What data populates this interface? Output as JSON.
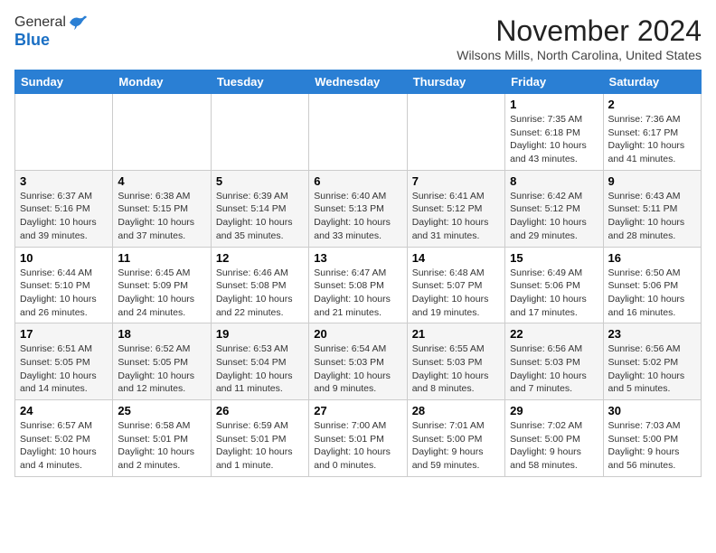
{
  "header": {
    "logo_general": "General",
    "logo_blue": "Blue",
    "month_title": "November 2024",
    "location": "Wilsons Mills, North Carolina, United States"
  },
  "days_of_week": [
    "Sunday",
    "Monday",
    "Tuesday",
    "Wednesday",
    "Thursday",
    "Friday",
    "Saturday"
  ],
  "weeks": [
    [
      {
        "day": "",
        "info": ""
      },
      {
        "day": "",
        "info": ""
      },
      {
        "day": "",
        "info": ""
      },
      {
        "day": "",
        "info": ""
      },
      {
        "day": "",
        "info": ""
      },
      {
        "day": "1",
        "info": "Sunrise: 7:35 AM\nSunset: 6:18 PM\nDaylight: 10 hours\nand 43 minutes."
      },
      {
        "day": "2",
        "info": "Sunrise: 7:36 AM\nSunset: 6:17 PM\nDaylight: 10 hours\nand 41 minutes."
      }
    ],
    [
      {
        "day": "3",
        "info": "Sunrise: 6:37 AM\nSunset: 5:16 PM\nDaylight: 10 hours\nand 39 minutes."
      },
      {
        "day": "4",
        "info": "Sunrise: 6:38 AM\nSunset: 5:15 PM\nDaylight: 10 hours\nand 37 minutes."
      },
      {
        "day": "5",
        "info": "Sunrise: 6:39 AM\nSunset: 5:14 PM\nDaylight: 10 hours\nand 35 minutes."
      },
      {
        "day": "6",
        "info": "Sunrise: 6:40 AM\nSunset: 5:13 PM\nDaylight: 10 hours\nand 33 minutes."
      },
      {
        "day": "7",
        "info": "Sunrise: 6:41 AM\nSunset: 5:12 PM\nDaylight: 10 hours\nand 31 minutes."
      },
      {
        "day": "8",
        "info": "Sunrise: 6:42 AM\nSunset: 5:12 PM\nDaylight: 10 hours\nand 29 minutes."
      },
      {
        "day": "9",
        "info": "Sunrise: 6:43 AM\nSunset: 5:11 PM\nDaylight: 10 hours\nand 28 minutes."
      }
    ],
    [
      {
        "day": "10",
        "info": "Sunrise: 6:44 AM\nSunset: 5:10 PM\nDaylight: 10 hours\nand 26 minutes."
      },
      {
        "day": "11",
        "info": "Sunrise: 6:45 AM\nSunset: 5:09 PM\nDaylight: 10 hours\nand 24 minutes."
      },
      {
        "day": "12",
        "info": "Sunrise: 6:46 AM\nSunset: 5:08 PM\nDaylight: 10 hours\nand 22 minutes."
      },
      {
        "day": "13",
        "info": "Sunrise: 6:47 AM\nSunset: 5:08 PM\nDaylight: 10 hours\nand 21 minutes."
      },
      {
        "day": "14",
        "info": "Sunrise: 6:48 AM\nSunset: 5:07 PM\nDaylight: 10 hours\nand 19 minutes."
      },
      {
        "day": "15",
        "info": "Sunrise: 6:49 AM\nSunset: 5:06 PM\nDaylight: 10 hours\nand 17 minutes."
      },
      {
        "day": "16",
        "info": "Sunrise: 6:50 AM\nSunset: 5:06 PM\nDaylight: 10 hours\nand 16 minutes."
      }
    ],
    [
      {
        "day": "17",
        "info": "Sunrise: 6:51 AM\nSunset: 5:05 PM\nDaylight: 10 hours\nand 14 minutes."
      },
      {
        "day": "18",
        "info": "Sunrise: 6:52 AM\nSunset: 5:05 PM\nDaylight: 10 hours\nand 12 minutes."
      },
      {
        "day": "19",
        "info": "Sunrise: 6:53 AM\nSunset: 5:04 PM\nDaylight: 10 hours\nand 11 minutes."
      },
      {
        "day": "20",
        "info": "Sunrise: 6:54 AM\nSunset: 5:03 PM\nDaylight: 10 hours\nand 9 minutes."
      },
      {
        "day": "21",
        "info": "Sunrise: 6:55 AM\nSunset: 5:03 PM\nDaylight: 10 hours\nand 8 minutes."
      },
      {
        "day": "22",
        "info": "Sunrise: 6:56 AM\nSunset: 5:03 PM\nDaylight: 10 hours\nand 7 minutes."
      },
      {
        "day": "23",
        "info": "Sunrise: 6:56 AM\nSunset: 5:02 PM\nDaylight: 10 hours\nand 5 minutes."
      }
    ],
    [
      {
        "day": "24",
        "info": "Sunrise: 6:57 AM\nSunset: 5:02 PM\nDaylight: 10 hours\nand 4 minutes."
      },
      {
        "day": "25",
        "info": "Sunrise: 6:58 AM\nSunset: 5:01 PM\nDaylight: 10 hours\nand 2 minutes."
      },
      {
        "day": "26",
        "info": "Sunrise: 6:59 AM\nSunset: 5:01 PM\nDaylight: 10 hours\nand 1 minute."
      },
      {
        "day": "27",
        "info": "Sunrise: 7:00 AM\nSunset: 5:01 PM\nDaylight: 10 hours\nand 0 minutes."
      },
      {
        "day": "28",
        "info": "Sunrise: 7:01 AM\nSunset: 5:00 PM\nDaylight: 9 hours\nand 59 minutes."
      },
      {
        "day": "29",
        "info": "Sunrise: 7:02 AM\nSunset: 5:00 PM\nDaylight: 9 hours\nand 58 minutes."
      },
      {
        "day": "30",
        "info": "Sunrise: 7:03 AM\nSunset: 5:00 PM\nDaylight: 9 hours\nand 56 minutes."
      }
    ]
  ]
}
